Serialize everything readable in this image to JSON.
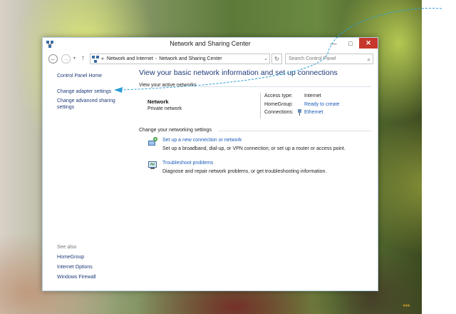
{
  "window": {
    "title": "Network and Sharing Center",
    "min_glyph": "—",
    "max_glyph": "□",
    "close_glyph": "✕"
  },
  "nav": {
    "back_glyph": "←",
    "forward_glyph": "→",
    "dropdown_glyph": "▾",
    "up_glyph": "↑",
    "address_prefix": "«",
    "breadcrumb": [
      "Network and Internet",
      "Network and Sharing Center"
    ],
    "breadcrumb_sep": "›",
    "address_dropdown": "⌄",
    "refresh_glyph": "↻",
    "search_placeholder": "Search Control Panel",
    "search_glyph": "⌕"
  },
  "left_pane": {
    "home": "Control Panel Home",
    "adapter": "Change adapter settings",
    "advanced_line1": "Change advanced sharing",
    "advanced_line2": "settings",
    "see_also": "See also",
    "see_also_links": [
      "HomeGroup",
      "Internet Options",
      "Windows Firewall"
    ]
  },
  "main": {
    "title": "View your basic network information and set up connections",
    "active_networks_heading": "View your active networks",
    "network_name": "Network",
    "network_type": "Private network",
    "access_type_label": "Access type:",
    "access_type_value": "Internet",
    "homegroup_label": "HomeGroup:",
    "homegroup_value": "Ready to create",
    "connections_label": "Connections:",
    "connections_value": "Ethernet",
    "change_settings_heading": "Change your networking settings",
    "tasks": [
      {
        "icon": "new-connection-icon",
        "link": "Set up a new connection or network",
        "desc": "Set up a broadband, dial-up, or VPN connection; or set up a router or access point."
      },
      {
        "icon": "troubleshoot-icon",
        "link": "Troubleshoot problems",
        "desc": "Diagnose and repair network problems, or get troubleshooting information."
      }
    ]
  },
  "colors": {
    "link": "#1e5bb8",
    "heading_link": "#1e3a78",
    "close_button": "#c7382c",
    "annotation": "#2a9fd6"
  },
  "watermark": "●●●"
}
